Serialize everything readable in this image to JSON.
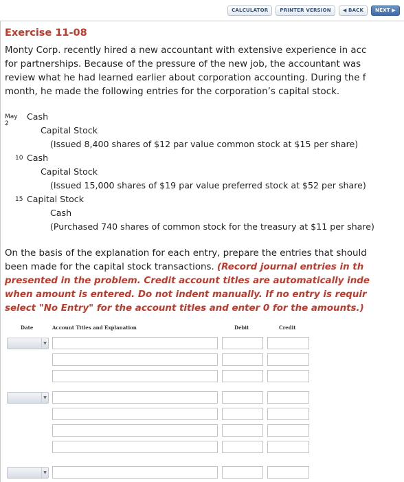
{
  "toolbar": {
    "calculator": "CALCULATOR",
    "printer": "PRINTER VERSION",
    "back": "◀ BACK",
    "next": "NEXT ▶"
  },
  "exercise": {
    "title": "Exercise 11-08",
    "paragraph": [
      "Monty Corp. recently hired a new accountant with extensive experience in acc",
      "for partnerships. Because of the pressure of the new job, the accountant was",
      "review what he had learned earlier about corporation accounting. During the f",
      "month, he made the following entries for the corporation’s capital stock."
    ]
  },
  "entries": {
    "e1": {
      "date": "May 2",
      "debit": "Cash",
      "credit": "Capital Stock",
      "note": "(Issued 8,400 shares of $12 par value common stock at $15 per share)"
    },
    "e2": {
      "date": "10",
      "debit": "Cash",
      "credit": "Capital Stock",
      "note": "(Issued 15,000 shares of $19 par value preferred stock at $52 per share)"
    },
    "e3": {
      "date": "15",
      "debit": "Capital Stock",
      "credit": "Cash",
      "note": "(Purchased 740 shares of common stock for the treasury at $11 per share)"
    }
  },
  "instructions": {
    "line1": "On the basis of the explanation for each entry, prepare the entries that should",
    "line2a": "been made for the capital stock transactions. ",
    "line2b": "(Record journal entries in th",
    "line3": "presented in the problem. Credit account titles are automatically inde",
    "line4": "when amount is entered. Do not indent manually. If no entry is requir",
    "line5": "select \"No Entry\" for the account titles and enter 0 for the amounts.)"
  },
  "journal": {
    "headers": {
      "date": "Date",
      "account": "Account Titles and Explanation",
      "debit": "Debit",
      "credit": "Credit"
    }
  }
}
